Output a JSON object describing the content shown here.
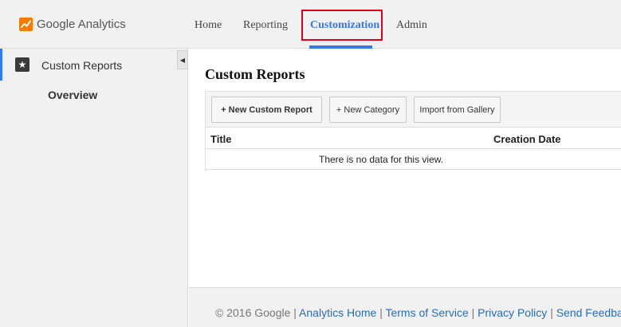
{
  "app": {
    "logo_text": "Google Analytics",
    "logo_icon": "google-analytics-logo-icon"
  },
  "nav": {
    "items": [
      {
        "label": "Home"
      },
      {
        "label": "Reporting"
      },
      {
        "label": "Customization",
        "active": true
      },
      {
        "label": "Admin"
      }
    ]
  },
  "sidebar": {
    "section_label": "Custom Reports",
    "section_icon": "star-icon",
    "collapse_icon": "chevron-left-icon",
    "overview_label": "Overview"
  },
  "main": {
    "title": "Custom Reports",
    "toolbar": {
      "new_report": "+ New Custom Report",
      "new_category": "+ New Category",
      "import": "Import from Gallery"
    },
    "table": {
      "columns": [
        "Title",
        "Creation Date"
      ],
      "empty_text": "There is no data for this view."
    }
  },
  "footer": {
    "copyright": "© 2016 Google",
    "separator": "|",
    "links": [
      "Analytics Home",
      "Terms of Service",
      "Privacy Policy",
      "Send Feedback"
    ]
  },
  "colors": {
    "accent": "#3b78e7",
    "highlight_box": "#e0001b",
    "logo_orange": "#f57c00",
    "link": "#2a6db5"
  }
}
